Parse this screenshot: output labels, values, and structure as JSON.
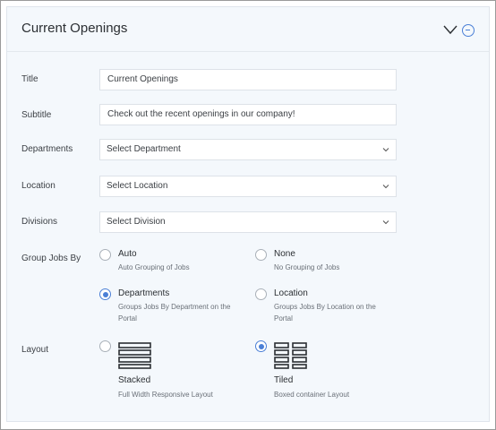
{
  "header": {
    "title": "Current Openings"
  },
  "fields": {
    "title": {
      "label": "Title",
      "value": "Current Openings"
    },
    "subtitle": {
      "label": "Subtitle",
      "value": "Check out the recent openings in our company!"
    },
    "departments": {
      "label": "Departments",
      "value": "Select Department"
    },
    "location": {
      "label": "Location",
      "value": "Select Location"
    },
    "divisions": {
      "label": "Divisions",
      "value": "Select Division"
    }
  },
  "group_jobs_by": {
    "label": "Group Jobs By",
    "selected": "Departments",
    "options": [
      {
        "title": "Auto",
        "desc": "Auto Grouping of Jobs"
      },
      {
        "title": "None",
        "desc": "No Grouping of Jobs"
      },
      {
        "title": "Departments",
        "desc": "Groups Jobs By Department on the Portal"
      },
      {
        "title": "Location",
        "desc": "Groups Jobs By Location on the Portal"
      }
    ]
  },
  "layout": {
    "label": "Layout",
    "selected": "Tiled",
    "options": [
      {
        "title": "Stacked",
        "desc": "Full Width Responsive Layout",
        "icon": "stacked-layout-icon"
      },
      {
        "title": "Tiled",
        "desc": "Boxed container Layout",
        "icon": "tiled-layout-icon"
      }
    ]
  },
  "colors": {
    "accent": "#4a7fd6",
    "panel_bg": "#f4f8fc"
  }
}
